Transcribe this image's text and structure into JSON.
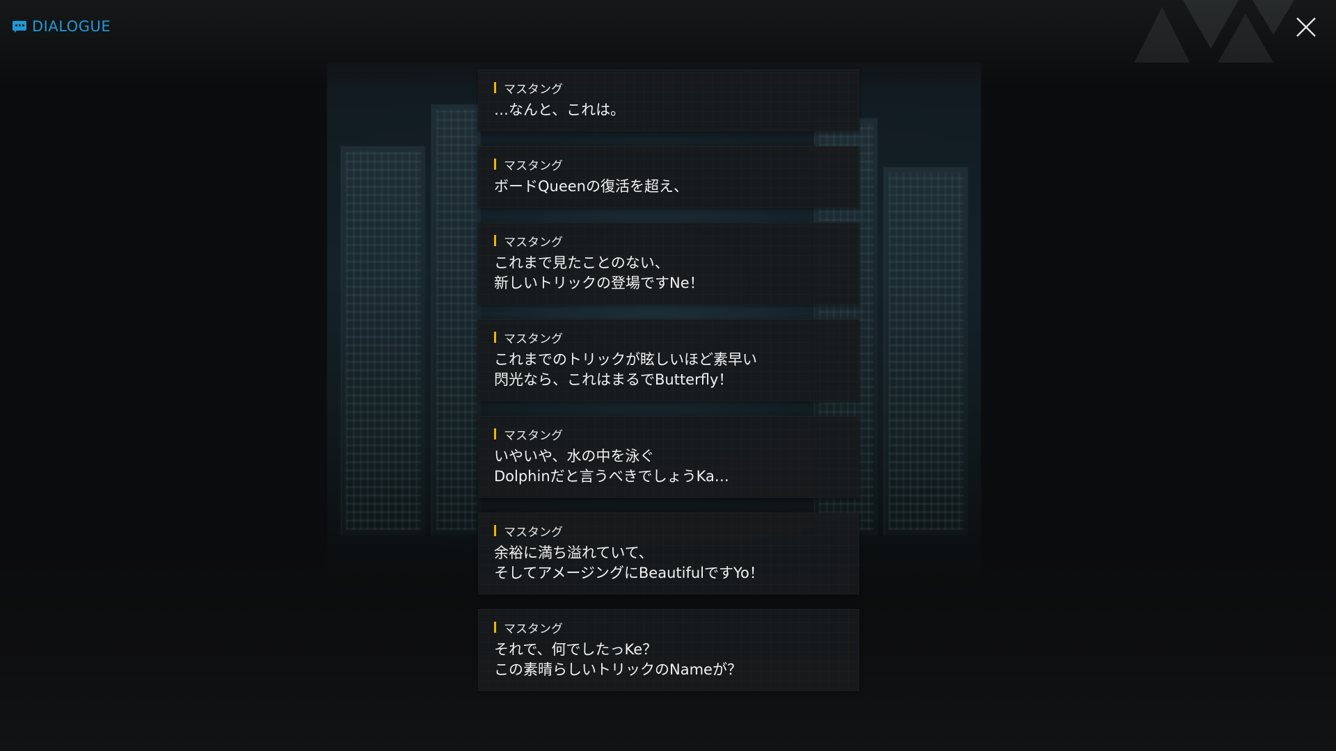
{
  "header": {
    "title": "DIALOGUE",
    "icon": "chat-bubble-icon",
    "accent_color": "#1e9bd7"
  },
  "close": {
    "icon": "close-icon"
  },
  "speaker_marker_color": "#f2b400",
  "entries": [
    {
      "speaker": "マスタング",
      "lines": [
        "…なんと、これは。"
      ]
    },
    {
      "speaker": "マスタング",
      "lines": [
        "ボードQueenの復活を超え、"
      ]
    },
    {
      "speaker": "マスタング",
      "lines": [
        "これまで見たことのない、",
        "新しいトリックの登場ですNe！"
      ]
    },
    {
      "speaker": "マスタング",
      "lines": [
        "これまでのトリックが眩しいほど素早い",
        "閃光なら、これはまるでButterfly！"
      ]
    },
    {
      "speaker": "マスタング",
      "lines": [
        "いやいや、水の中を泳ぐ",
        "Dolphinだと言うべきでしょうKa…"
      ]
    },
    {
      "speaker": "マスタング",
      "lines": [
        "余裕に満ち溢れていて、",
        "そしてアメージングにBeautifulですYo！"
      ]
    },
    {
      "speaker": "マスタング",
      "lines": [
        "それで、何でしたっKe？",
        "この素晴らしいトリックのNameが？"
      ]
    }
  ]
}
